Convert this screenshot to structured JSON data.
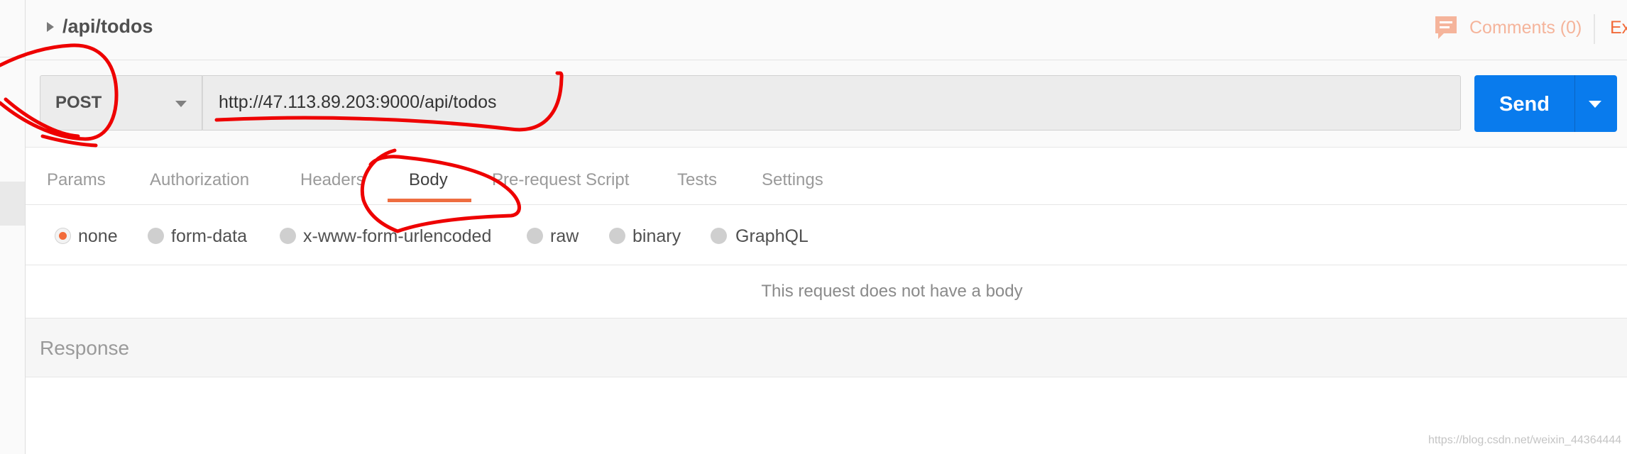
{
  "request": {
    "title": "/api/todos",
    "method": "POST",
    "url": "http://47.113.89.203:9000/api/todos"
  },
  "header_actions": {
    "comments_label": "Comments (0)",
    "examples_label": "Ex"
  },
  "send": {
    "label": "Send"
  },
  "tabs": [
    {
      "label": "Params",
      "active": false
    },
    {
      "label": "Authorization",
      "active": false
    },
    {
      "label": "Headers",
      "active": false
    },
    {
      "label": "Body",
      "active": true
    },
    {
      "label": "Pre-request Script",
      "active": false
    },
    {
      "label": "Tests",
      "active": false
    },
    {
      "label": "Settings",
      "active": false
    }
  ],
  "body_types": [
    {
      "label": "none",
      "selected": true
    },
    {
      "label": "form-data",
      "selected": false
    },
    {
      "label": "x-www-form-urlencoded",
      "selected": false
    },
    {
      "label": "raw",
      "selected": false
    },
    {
      "label": "binary",
      "selected": false
    },
    {
      "label": "GraphQL",
      "selected": false
    }
  ],
  "body_message": "This request does not have a body",
  "response": {
    "label": "Response"
  },
  "watermark": "https://blog.csdn.net/weixin_44364444",
  "colors": {
    "accent": "#f26b3a",
    "send_button": "#097bed",
    "annotation": "#ee0000"
  },
  "icons": {
    "comments": "comment-bubble-icon",
    "collapse": "caret-right-icon",
    "method_dropdown": "chevron-down-icon",
    "send_dropdown": "chevron-down-icon"
  }
}
